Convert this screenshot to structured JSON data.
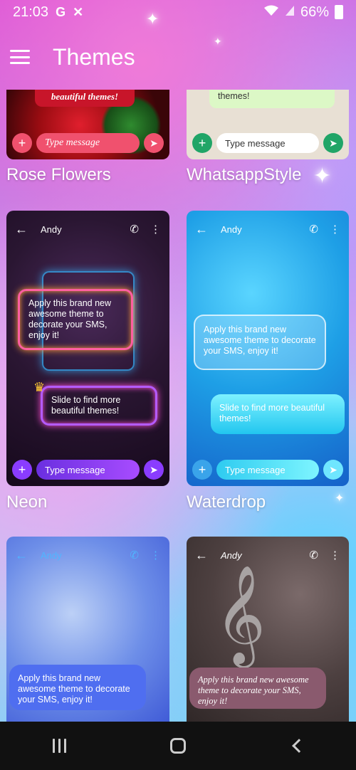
{
  "status_bar": {
    "time": "21:03",
    "icon_g": "G",
    "icon_x": "✕",
    "battery": "66%"
  },
  "app_bar": {
    "title": "Themes"
  },
  "themes": [
    {
      "name": "Rose Flowers",
      "sent": "beautiful themes!",
      "input": "Type message"
    },
    {
      "name": "WhatsappStyle",
      "sent": "themes!",
      "input": "Type message"
    },
    {
      "name": "Neon",
      "contact": "Andy",
      "received": "Apply this brand new awesome theme to decorate your SMS, enjoy it!",
      "sent": "Slide to find more beautiful themes!",
      "input": "Type message"
    },
    {
      "name": "Waterdrop",
      "contact": "Andy",
      "received": "Apply this brand new awesome theme to decorate your SMS, enjoy it!",
      "sent": "Slide to find more beautiful themes!",
      "input": "Type message"
    },
    {
      "contact": "Andy",
      "received": "Apply this brand new awesome theme to decorate your SMS, enjoy it!"
    },
    {
      "contact": "Andy",
      "received": "Apply this brand new awesome theme to decorate your SMS, enjoy it!"
    }
  ],
  "colors": {
    "accent_pink": "#f0516e",
    "neon_purple": "#8a3cff",
    "cyan": "#2ecbf0"
  }
}
